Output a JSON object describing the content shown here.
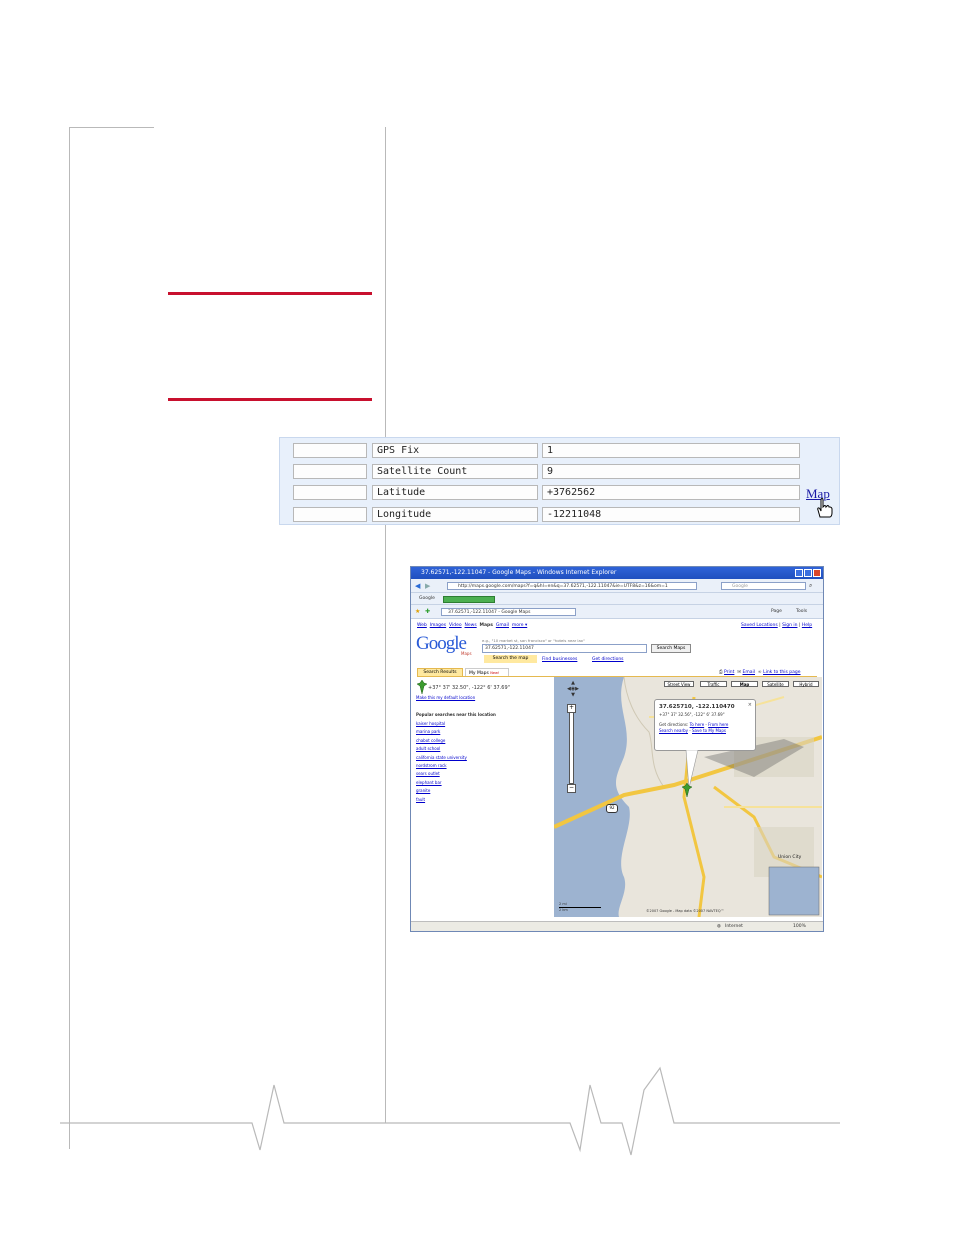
{
  "gps_table": {
    "rows": [
      {
        "label": "GPS Fix",
        "value": "1"
      },
      {
        "label": "Satellite Count",
        "value": "9"
      },
      {
        "label": "Latitude",
        "value": "+3762562"
      },
      {
        "label": "Longitude",
        "value": "-12211048"
      }
    ],
    "map_link": "Map"
  },
  "browser": {
    "title": "37.62571,-122.11047 - Google Maps - Windows Internet Explorer",
    "address": "http://maps.google.com/maps?f=q&hl=en&q=37.62571,-122.11047&ie=UTF8&z=16&om=1",
    "search_box_placeholder": "Google",
    "links_bar": "Google",
    "tab_title": "37.62571,-122.11047 - Google Maps",
    "toolbar_page": "Page",
    "toolbar_tools": "Tools",
    "nav_links": [
      "Web",
      "Images",
      "Video",
      "News",
      "Maps",
      "Gmail",
      "more ▾"
    ],
    "user_links": [
      "Saved Locations",
      "Sign in",
      "Help"
    ],
    "logo": "Google",
    "logo_sub": "Maps",
    "search_hint": "e.g., \"10 market st, san francisco\" or \"hotels near lax\"",
    "search_value": "37.62571,-122.11047",
    "search_button": "Search Maps",
    "sub_tabs": [
      "Search the map",
      "Find businesses",
      "Get directions"
    ],
    "panel_tabs": [
      "Search Results",
      "My Maps"
    ],
    "my_maps_badge": "New!",
    "page_actions": [
      "Print",
      "Email",
      "Link to this page"
    ],
    "result_coords": "+37° 37' 32.50\", -122° 6' 37.69\"",
    "make_default": "Make this my default location",
    "popular_heading": "Popular searches near this location",
    "popular": [
      "kaiser hospital",
      "marina park",
      "chabot college",
      "adult school",
      "california state university",
      "nordstrom rack",
      "sears outlet",
      "elephant bar",
      "granite",
      "fault"
    ],
    "map_types": [
      "Street View",
      "Traffic",
      "Map",
      "Satellite",
      "Hybrid"
    ],
    "infowindow": {
      "title": "37.625710, -122.110470",
      "coords": "+37° 37' 32.56\", -122° 6' 37.69\"",
      "directions_label": "Get directions:",
      "to_here": "To here",
      "from_here": "From here",
      "search_nearby": "Search nearby",
      "save": "Save to My Maps"
    },
    "map_labels": [
      "Union City",
      "92"
    ],
    "scale": [
      "2 mi",
      "2 km"
    ],
    "copyright": "©2007 Google - Map data ©2007 NAVTEQ™",
    "status_zone": "Internet",
    "zoom": "100%"
  },
  "colors": {
    "red_rule": "#c8102e",
    "panel_bg": "#e8f0fb",
    "link": "#1a1aa6"
  }
}
